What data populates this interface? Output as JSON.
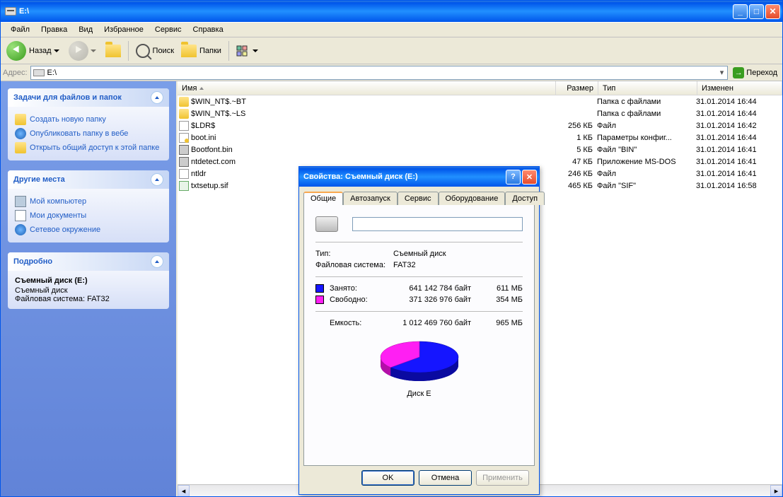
{
  "window": {
    "title": "E:\\"
  },
  "menu": [
    "Файл",
    "Правка",
    "Вид",
    "Избранное",
    "Сервис",
    "Справка"
  ],
  "toolbar": {
    "back": "Назад",
    "search": "Поиск",
    "folders": "Папки"
  },
  "address": {
    "label": "Адрес:",
    "value": "E:\\",
    "go": "Переход"
  },
  "sidebar": {
    "tasks": {
      "title": "Задачи для файлов и папок",
      "items": [
        "Создать новую папку",
        "Опубликовать папку в вебе",
        "Открыть общий доступ к этой папке"
      ]
    },
    "places": {
      "title": "Другие места",
      "items": [
        "Мой компьютер",
        "Мои документы",
        "Сетевое окружение"
      ]
    },
    "details": {
      "title": "Подробно",
      "name": "Съемный диск (E:)",
      "type": "Съемный диск",
      "fs": "Файловая система: FAT32"
    }
  },
  "columns": {
    "name": "Имя",
    "size": "Размер",
    "type": "Тип",
    "date": "Изменен"
  },
  "files": [
    {
      "icon": "folder",
      "name": "$WIN_NT$.~BT",
      "size": "",
      "type": "Папка с файлами",
      "date": "31.01.2014 16:44"
    },
    {
      "icon": "folder",
      "name": "$WIN_NT$.~LS",
      "size": "",
      "type": "Папка с файлами",
      "date": "31.01.2014 16:44"
    },
    {
      "icon": "file",
      "name": "$LDR$",
      "size": "256 КБ",
      "type": "Файл",
      "date": "31.01.2014 16:42"
    },
    {
      "icon": "ini",
      "name": "boot.ini",
      "size": "1 КБ",
      "type": "Параметры конфиг...",
      "date": "31.01.2014 16:44"
    },
    {
      "icon": "bin",
      "name": "Bootfont.bin",
      "size": "5 КБ",
      "type": "Файл \"BIN\"",
      "date": "31.01.2014 16:41"
    },
    {
      "icon": "bin",
      "name": "ntdetect.com",
      "size": "47 КБ",
      "type": "Приложение MS-DOS",
      "date": "31.01.2014 16:41"
    },
    {
      "icon": "file",
      "name": "ntldr",
      "size": "246 КБ",
      "type": "Файл",
      "date": "31.01.2014 16:41"
    },
    {
      "icon": "txt",
      "name": "txtsetup.sif",
      "size": "465 КБ",
      "type": "Файл \"SIF\"",
      "date": "31.01.2014 16:58"
    }
  ],
  "dialog": {
    "title": "Свойства: Съемный диск (E:)",
    "tabs": [
      "Общие",
      "Автозапуск",
      "Сервис",
      "Оборудование",
      "Доступ"
    ],
    "type_label": "Тип:",
    "type_value": "Съемный диск",
    "fs_label": "Файловая система:",
    "fs_value": "FAT32",
    "used_label": "Занято:",
    "used_bytes": "641 142 784 байт",
    "used_mb": "611 МБ",
    "free_label": "Свободно:",
    "free_bytes": "371 326 976 байт",
    "free_mb": "354 МБ",
    "cap_label": "Емкость:",
    "cap_bytes": "1 012 469 760 байт",
    "cap_mb": "965 МБ",
    "disk_label": "Диск E",
    "buttons": {
      "ok": "OK",
      "cancel": "Отмена",
      "apply": "Применить"
    }
  },
  "chart_data": {
    "type": "pie",
    "title": "Диск E",
    "series": [
      {
        "name": "Занято",
        "value": 641142784,
        "pct": 63.3,
        "color": "#1515ff"
      },
      {
        "name": "Свободно",
        "value": 371326976,
        "pct": 36.7,
        "color": "#ff1ff3"
      }
    ],
    "total": 1012469760
  }
}
